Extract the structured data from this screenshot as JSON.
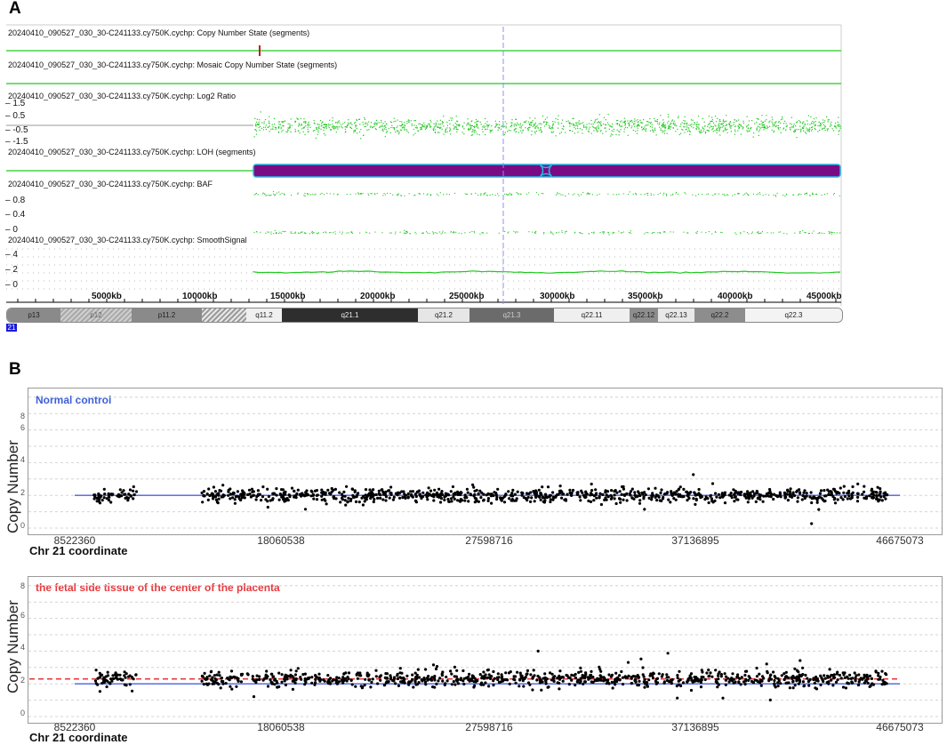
{
  "panel_a": {
    "letter": "A",
    "tracks": {
      "cn_state": "20240410_090527_030_30-C241133.cy750K.cychp: Copy Number State (segments)",
      "mosaic": "20240410_090527_030_30-C241133.cy750K.cychp: Mosaic Copy Number State (segments)",
      "log2": "20240410_090527_030_30-C241133.cy750K.cychp: Log2 Ratio",
      "loh": "20240410_090527_030_30-C241133.cy750K.cychp: LOH (segments)",
      "baf": "20240410_090527_030_30-C241133.cy750K.cychp: BAF",
      "smooth": "20240410_090527_030_30-C241133.cy750K.cychp: SmoothSignal"
    },
    "log2_ticks": [
      "1.5",
      "0.5",
      "-0.5",
      "-1.5"
    ],
    "baf_ticks": [
      "0.8",
      "0.4",
      "0"
    ],
    "smooth_ticks": [
      "4",
      "2",
      "0"
    ],
    "coord_ticks": [
      "5000kb",
      "10000kb",
      "15000kb",
      "20000kb",
      "25000kb",
      "30000kb",
      "35000kb",
      "40000kb",
      "45000kb"
    ],
    "cytobands": [
      {
        "name": "p13",
        "color": "#8a8a8a"
      },
      {
        "name": "p12",
        "color": "#c8c8c8"
      },
      {
        "name": "p11.2",
        "color": "#8a8a8a"
      },
      {
        "name": "",
        "color": "#bdbdbd"
      },
      {
        "name": "q11.2",
        "color": "#f0f0f0"
      },
      {
        "name": "q21.1",
        "color": "#2e2e2e"
      },
      {
        "name": "q21.2",
        "color": "#e6e6e6"
      },
      {
        "name": "q21.3",
        "color": "#6b6b6b"
      },
      {
        "name": "q22.11",
        "color": "#efefef"
      },
      {
        "name": "q22.12",
        "color": "#8d8d8d"
      },
      {
        "name": "q22.13",
        "color": "#e8e8e8"
      },
      {
        "name": "q22.2",
        "color": "#8d8d8d"
      },
      {
        "name": "q22.3",
        "color": "#f3f3f3"
      }
    ],
    "chromosome_label": "21",
    "colors": {
      "signal": "#22c922",
      "loh": "#7b0a85",
      "loh_border": "#27b6e0",
      "cursor": "#8c8cff",
      "cn_marker": "#c91d1d"
    }
  },
  "panel_b": {
    "letter": "B",
    "plots": [
      {
        "title": "Normal control",
        "title_color": "#3d5fd9",
        "ylabel": "Copy Number",
        "xlabel": "Chr 21 coordinate",
        "yticks": [
          "0",
          "2",
          "4",
          "6",
          "8"
        ],
        "xticks": [
          "8522360",
          "18060538",
          "27598716",
          "37136895",
          "46675073"
        ]
      },
      {
        "title": "the fetal side tissue of the center of the placenta",
        "title_color": "#e8383d",
        "ylabel": "Copy Number",
        "xlabel": "Chr 21 coordinate",
        "yticks": [
          "0",
          "2",
          "4",
          "6",
          "8"
        ],
        "xticks": [
          "8522360",
          "18060538",
          "27598716",
          "37136895",
          "46675073"
        ]
      }
    ]
  },
  "chart_data": [
    {
      "type": "scatter",
      "title": "Normal control",
      "xlabel": "Chr 21 coordinate",
      "ylabel": "Copy Number",
      "xlim": [
        8522360,
        46675073
      ],
      "ylim": [
        0,
        8
      ],
      "x_ticks": [
        8522360,
        18060538,
        27598716,
        37136895,
        46675073
      ],
      "y_ticks": [
        0,
        2,
        4,
        6,
        8
      ],
      "segment_copy_number": 2.0,
      "points_mean": 2.0,
      "points_spread": 0.35,
      "point_clusters": [
        {
          "x_start": 9400000,
          "x_end": 11400000
        },
        {
          "x_start": 14400000,
          "x_end": 46100000
        }
      ],
      "grid": true,
      "segment_color": "#4b5fe0",
      "point_color": "#000000"
    },
    {
      "type": "scatter",
      "title": "the fetal side tissue of the center of the placenta",
      "xlabel": "Chr 21 coordinate",
      "ylabel": "Copy Number",
      "xlim": [
        8522360,
        46675073
      ],
      "ylim": [
        0,
        8
      ],
      "x_ticks": [
        8522360,
        18060538,
        27598716,
        37136895,
        46675073
      ],
      "y_ticks": [
        0,
        2,
        4,
        6,
        8
      ],
      "segment_copy_number": 2.0,
      "mosaic_copy_number": 2.3,
      "points_mean": 2.3,
      "points_spread": 0.4,
      "point_clusters": [
        {
          "x_start": 9400000,
          "x_end": 11400000
        },
        {
          "x_start": 14400000,
          "x_end": 46100000
        }
      ],
      "grid": true,
      "segment_color": "#4b5fe0",
      "mosaic_color": "#e8383d",
      "point_color": "#000000"
    }
  ]
}
